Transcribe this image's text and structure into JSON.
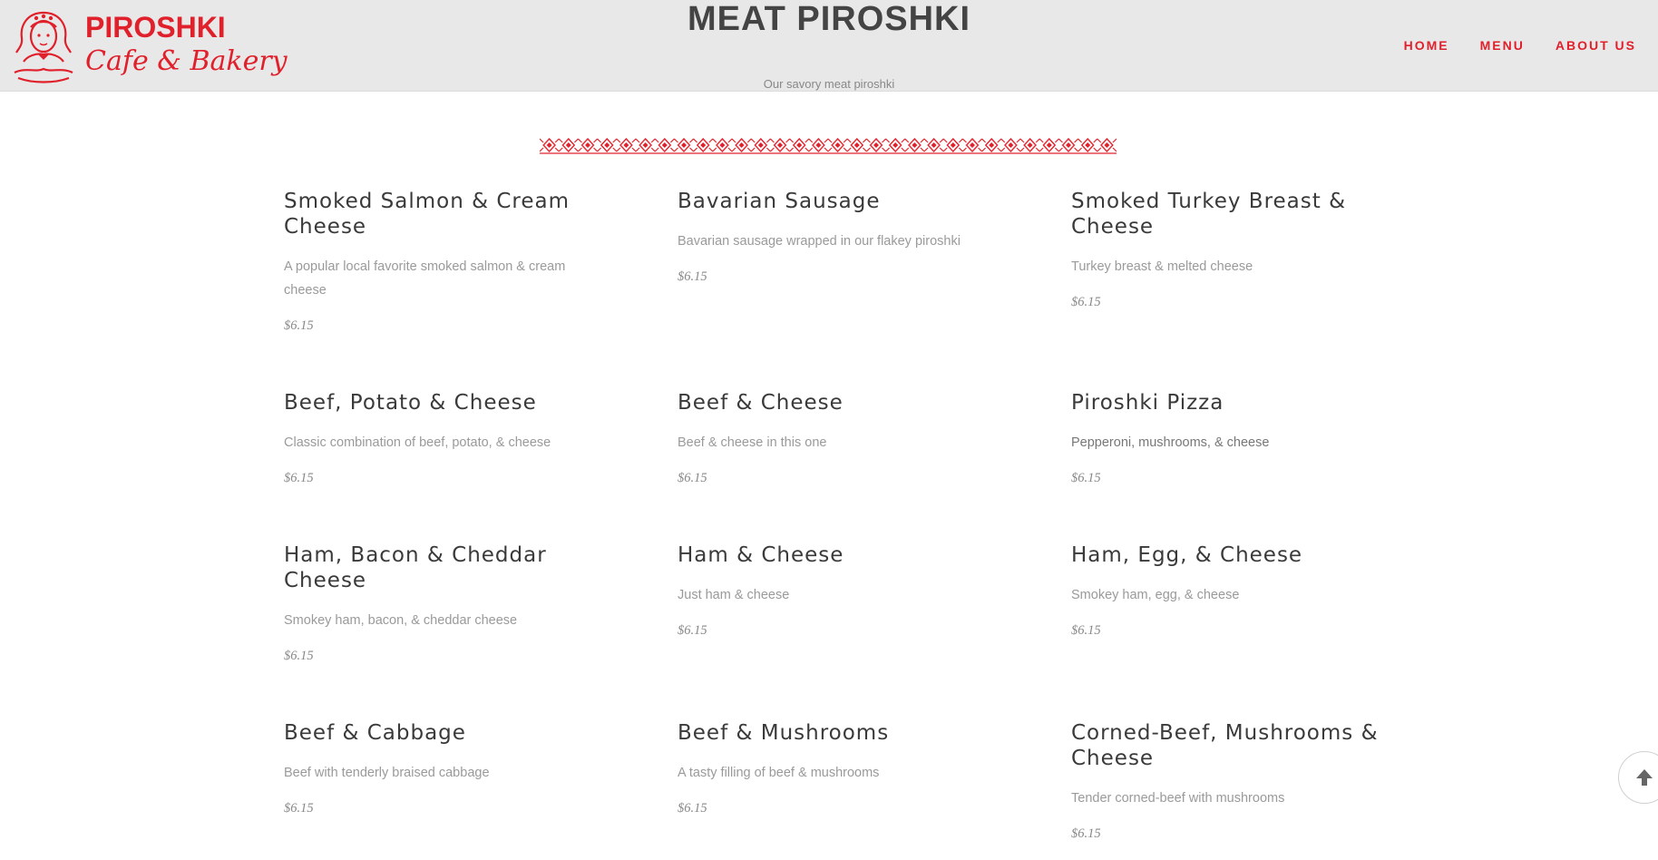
{
  "brand": {
    "name": "PIROSHKI",
    "tagline": "Cafe & Bakery",
    "accent_color": "#e0202b"
  },
  "header": {
    "title": "MEAT PIROSHKI",
    "subtitle": "Our savory meat piroshki"
  },
  "nav": {
    "items": [
      {
        "label": "HOME"
      },
      {
        "label": "MENU"
      },
      {
        "label": "ABOUT US"
      }
    ]
  },
  "menu": {
    "items": [
      {
        "name": "Smoked Salmon & Cream Cheese",
        "description": "A popular local favorite smoked salmon & cream cheese",
        "price": "$6.15"
      },
      {
        "name": "Bavarian Sausage",
        "description": "Bavarian sausage wrapped in our flakey piroshki",
        "price": "$6.15"
      },
      {
        "name": "Smoked Turkey Breast & Cheese",
        "description": "Turkey breast & melted cheese",
        "price": "$6.15"
      },
      {
        "name": "Beef, Potato & Cheese",
        "description": "Classic combination of beef, potato, & cheese",
        "price": "$6.15"
      },
      {
        "name": "Beef & Cheese",
        "description": "Beef & cheese in this one",
        "price": "$6.15"
      },
      {
        "name": "Piroshki Pizza",
        "description": "Pepperoni, mushrooms, & cheese",
        "price": "$6.15"
      },
      {
        "name": "Ham, Bacon & Cheddar Cheese",
        "description": "Smokey ham, bacon, & cheddar cheese",
        "price": "$6.15"
      },
      {
        "name": "Ham & Cheese",
        "description": "Just ham & cheese",
        "price": "$6.15"
      },
      {
        "name": "Ham, Egg, & Cheese",
        "description": "Smokey ham, egg, & cheese",
        "price": "$6.15"
      },
      {
        "name": "Beef & Cabbage",
        "description": "Beef with tenderly braised cabbage",
        "price": "$6.15"
      },
      {
        "name": "Beef & Mushrooms",
        "description": "A tasty filling of beef & mushrooms",
        "price": "$6.15"
      },
      {
        "name": "Corned-Beef, Mushrooms & Cheese",
        "description": "Tender corned-beef with mushrooms",
        "price": "$6.15"
      }
    ]
  },
  "icons": {
    "logo": "matryoshka-girl-logo-icon",
    "divider": "embroidery-ornament-icon",
    "scroll_top": "arrow-up-icon"
  }
}
